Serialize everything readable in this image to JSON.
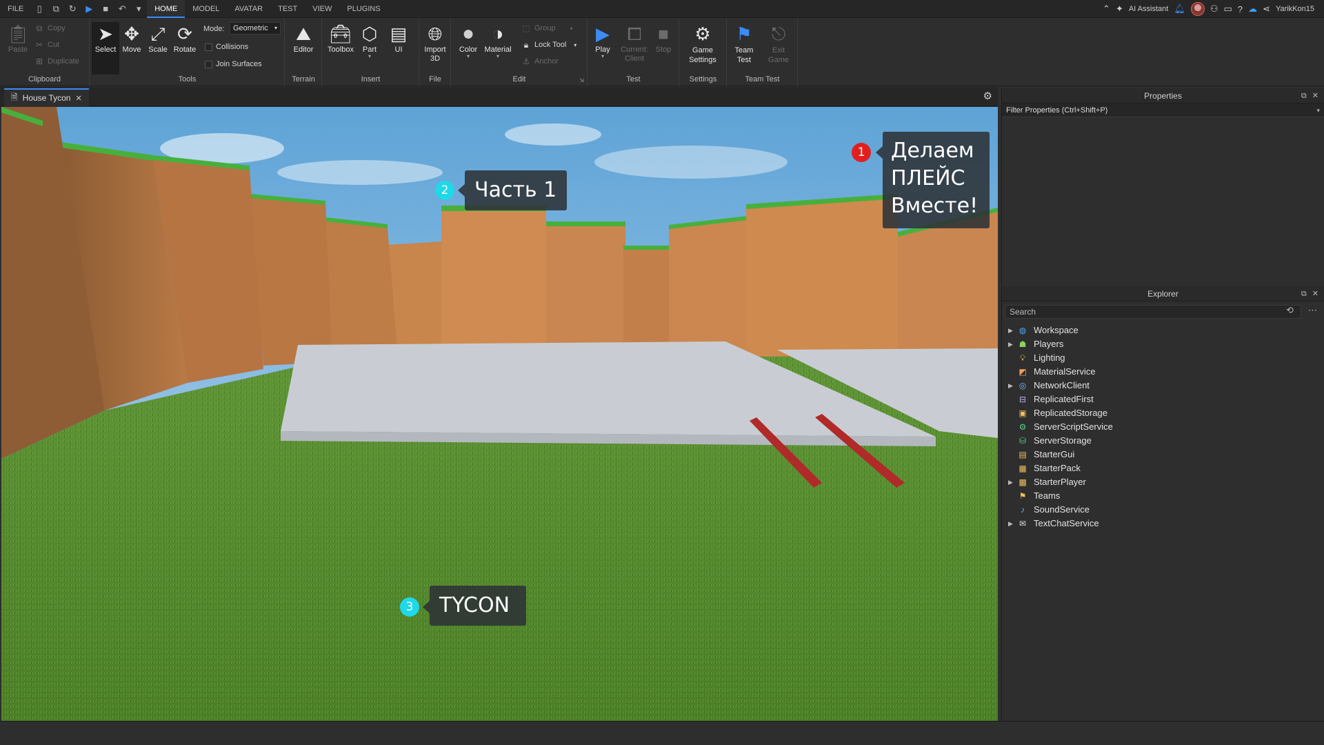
{
  "menubar": {
    "file": "FILE",
    "tabs": [
      "HOME",
      "MODEL",
      "AVATAR",
      "TEST",
      "VIEW",
      "PLUGINS"
    ],
    "active_tab": "HOME",
    "ai_assistant": "AI Assistant",
    "username": "YarikKon15"
  },
  "ribbon": {
    "clipboard": {
      "label": "Clipboard",
      "paste": "Paste",
      "copy": "Copy",
      "cut": "Cut",
      "duplicate": "Duplicate"
    },
    "tools": {
      "label": "Tools",
      "select": "Select",
      "move": "Move",
      "scale": "Scale",
      "rotate": "Rotate",
      "mode_label": "Mode:",
      "mode_value": "Geometric",
      "collisions": "Collisions",
      "join_surfaces": "Join Surfaces"
    },
    "terrain": {
      "label": "Terrain",
      "editor": "Editor"
    },
    "insert": {
      "label": "Insert",
      "toolbox": "Toolbox",
      "part": "Part",
      "ui": "UI"
    },
    "file": {
      "label": "File",
      "import3d": "Import 3D"
    },
    "edit": {
      "label": "Edit",
      "color": "Color",
      "material": "Material",
      "group": "Group",
      "lock_tool": "Lock Tool",
      "anchor": "Anchor"
    },
    "test": {
      "label": "Test",
      "play": "Play",
      "current_client": "Current: Client",
      "stop": "Stop"
    },
    "settings": {
      "label": "Settings",
      "game_settings": "Game Settings"
    },
    "team_test": {
      "label": "Team Test",
      "team_test": "Team Test",
      "exit_game": "Exit Game"
    }
  },
  "document": {
    "tab_title": "House Tycon"
  },
  "viewport": {
    "callouts": [
      {
        "number": "1",
        "text_lines": [
          "Делаем",
          "ПЛЕЙС",
          "Вместе!"
        ],
        "badge_color": "#e31e1e"
      },
      {
        "number": "2",
        "text": "Часть 1",
        "badge_color": "#1fd8e8"
      },
      {
        "number": "3",
        "text": "TYCON",
        "badge_color": "#1fd8e8"
      }
    ]
  },
  "properties": {
    "title": "Properties",
    "filter_placeholder": "Filter Properties (Ctrl+Shift+P)"
  },
  "explorer": {
    "title": "Explorer",
    "search_placeholder": "Search",
    "items": [
      {
        "name": "Workspace",
        "expandable": true,
        "icon": "globe-icon"
      },
      {
        "name": "Players",
        "expandable": true,
        "icon": "players-icon"
      },
      {
        "name": "Lighting",
        "expandable": false,
        "icon": "lightbulb-icon"
      },
      {
        "name": "MaterialService",
        "expandable": false,
        "icon": "material-service-icon"
      },
      {
        "name": "NetworkClient",
        "expandable": true,
        "icon": "network-icon"
      },
      {
        "name": "ReplicatedFirst",
        "expandable": false,
        "icon": "replicated-first-icon"
      },
      {
        "name": "ReplicatedStorage",
        "expandable": false,
        "icon": "replicated-storage-icon"
      },
      {
        "name": "ServerScriptService",
        "expandable": false,
        "icon": "server-script-icon"
      },
      {
        "name": "ServerStorage",
        "expandable": false,
        "icon": "server-storage-icon"
      },
      {
        "name": "StarterGui",
        "expandable": false,
        "icon": "starter-gui-icon"
      },
      {
        "name": "StarterPack",
        "expandable": false,
        "icon": "starter-pack-icon"
      },
      {
        "name": "StarterPlayer",
        "expandable": true,
        "icon": "starter-player-icon"
      },
      {
        "name": "Teams",
        "expandable": false,
        "icon": "teams-icon"
      },
      {
        "name": "SoundService",
        "expandable": false,
        "icon": "sound-icon"
      },
      {
        "name": "TextChatService",
        "expandable": true,
        "icon": "chat-icon"
      }
    ]
  },
  "colors": {
    "accent": "#3b8cf6",
    "badge_red": "#e31e1e",
    "badge_cyan": "#1fd8e8",
    "grass": "#4f8a2b",
    "dirt": "#c9864e",
    "baseplate": "#c8ccd2"
  }
}
